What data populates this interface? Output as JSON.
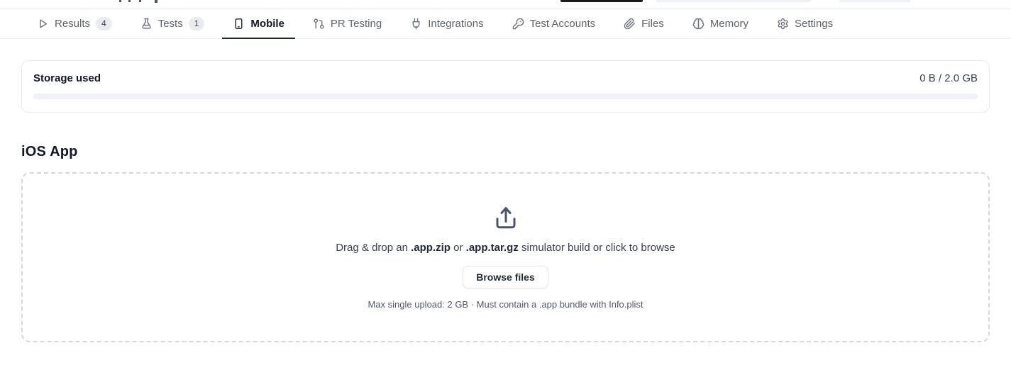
{
  "tabs": {
    "active": "Mobile",
    "items": [
      {
        "label": "Results",
        "icon": "play-icon",
        "badge": "4"
      },
      {
        "label": "Tests",
        "icon": "flask-icon",
        "badge": "1"
      },
      {
        "label": "Mobile",
        "icon": "smartphone-icon"
      },
      {
        "label": "PR Testing",
        "icon": "git-pull-request-icon"
      },
      {
        "label": "Integrations",
        "icon": "plug-icon"
      },
      {
        "label": "Test Accounts",
        "icon": "key-icon"
      },
      {
        "label": "Files",
        "icon": "paperclip-icon"
      },
      {
        "label": "Memory",
        "icon": "brain-icon"
      },
      {
        "label": "Settings",
        "icon": "gear-icon"
      }
    ]
  },
  "storage": {
    "label": "Storage used",
    "usage": "0 B / 2.0 GB",
    "progress_percent": 0
  },
  "ios_app": {
    "heading": "iOS App",
    "dropzone": {
      "icon": "upload-icon",
      "instruction": {
        "prefix": "Drag & drop an ",
        "format1": ".app.zip",
        "middle": " or ",
        "format2": ".app.tar.gz",
        "suffix": " simulator build or click to browse"
      },
      "browse_button": "Browse files",
      "hint": "Max single upload: 2 GB · Must contain a .app bundle with Info.plist"
    }
  },
  "colors": {
    "active_tab": "#1f2937",
    "inactive_tab": "#5b6472",
    "badge_bg": "#e8ecf1",
    "progress_track": "#eef2f7",
    "card_border": "#e7eaee",
    "dashed_border": "#d4d7dc"
  }
}
